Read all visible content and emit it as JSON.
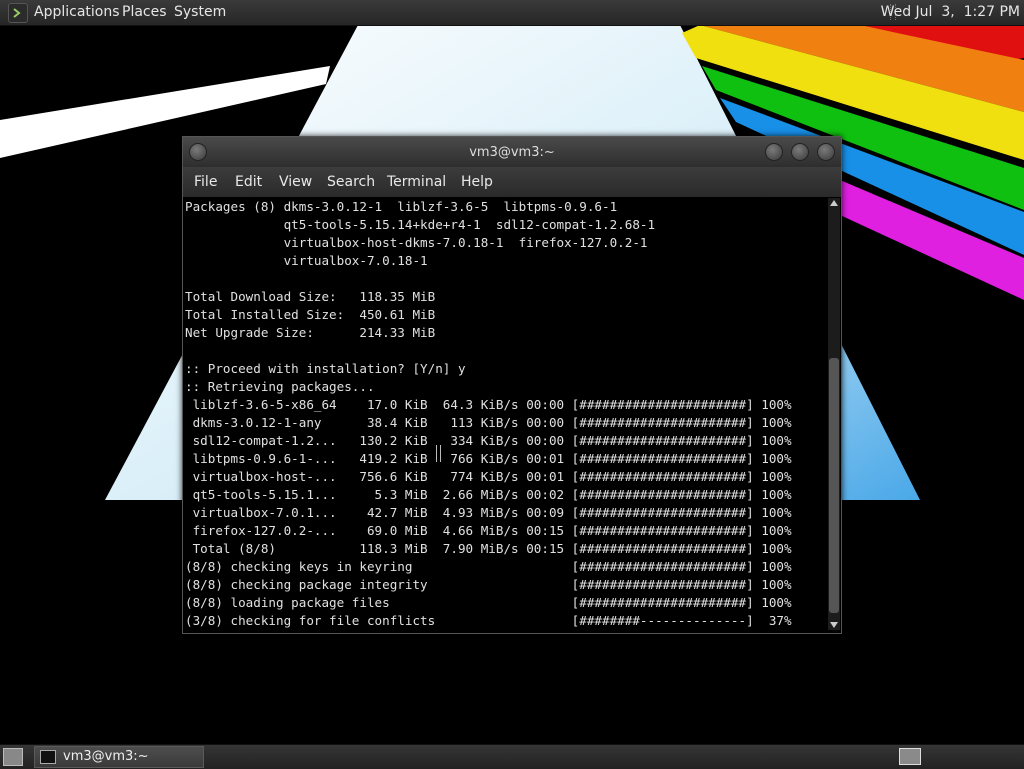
{
  "top_panel": {
    "menus": [
      "Applications",
      "Places",
      "System"
    ],
    "clock": "Wed Jul  3,  1:27 PM"
  },
  "window": {
    "title": "vm3@vm3:~",
    "menu": [
      "File",
      "Edit",
      "View",
      "Search",
      "Terminal",
      "Help"
    ]
  },
  "terminal": {
    "lines": [
      "Packages (8) dkms-3.0.12-1  liblzf-3.6-5  libtpms-0.9.6-1",
      "             qt5-tools-5.15.14+kde+r4-1  sdl12-compat-1.2.68-1",
      "             virtualbox-host-dkms-7.0.18-1  firefox-127.0.2-1",
      "             virtualbox-7.0.18-1",
      "",
      "Total Download Size:   118.35 MiB",
      "Total Installed Size:  450.61 MiB",
      "Net Upgrade Size:      214.33 MiB",
      "",
      ":: Proceed with installation? [Y/n] y",
      ":: Retrieving packages...",
      " liblzf-3.6-5-x86_64    17.0 KiB  64.3 KiB/s 00:00 [######################] 100%",
      " dkms-3.0.12-1-any      38.4 KiB   113 KiB/s 00:00 [######################] 100%",
      " sdl12-compat-1.2...   130.2 KiB   334 KiB/s 00:00 [######################] 100%",
      " libtpms-0.9.6-1-...   419.2 KiB   766 KiB/s 00:01 [######################] 100%",
      " virtualbox-host-...   756.6 KiB   774 KiB/s 00:01 [######################] 100%",
      " qt5-tools-5.15.1...     5.3 MiB  2.66 MiB/s 00:02 [######################] 100%",
      " virtualbox-7.0.1...    42.7 MiB  4.93 MiB/s 00:09 [######################] 100%",
      " firefox-127.0.2-...    69.0 MiB  4.66 MiB/s 00:15 [######################] 100%",
      " Total (8/8)           118.3 MiB  7.90 MiB/s 00:15 [######################] 100%",
      "(8/8) checking keys in keyring                     [######################] 100%",
      "(8/8) checking package integrity                   [######################] 100%",
      "(8/8) loading package files                        [######################] 100%",
      "(3/8) checking for file conflicts                  [########--------------]  37%"
    ]
  },
  "taskbar": {
    "window_label": "vm3@vm3:~"
  },
  "icons": {
    "panel_logo": "terminal-logo-icon",
    "show_desktop": "show-desktop-icon",
    "taskbar_window": "terminal-icon",
    "workspace": "workspace-switcher-icon"
  },
  "colors": {
    "wallpaper_rainbow": [
      "#e01010",
      "#f08010",
      "#f0e010",
      "#10c010",
      "#1890e8",
      "#e020e0"
    ],
    "prism": "#ffffff",
    "terminal_bg": "#000000",
    "terminal_fg": "#e0e0e0"
  }
}
